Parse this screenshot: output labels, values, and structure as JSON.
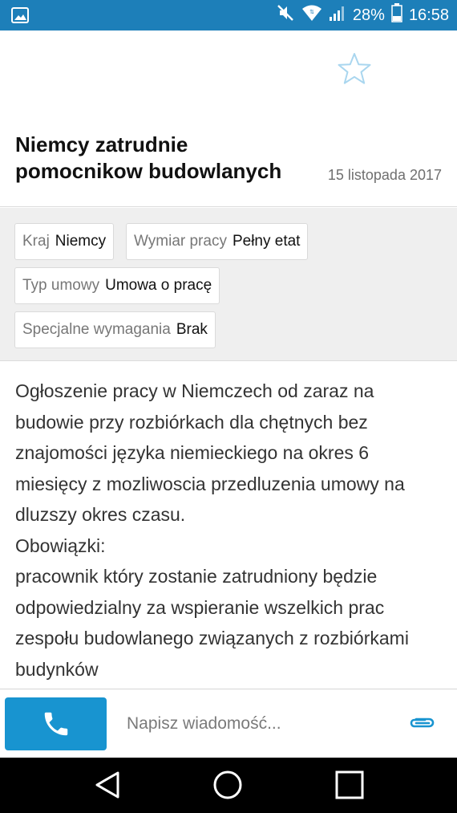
{
  "status_bar": {
    "battery": "28%",
    "time": "16:58",
    "icons": [
      "image-icon",
      "mute-icon",
      "wifi-icon",
      "signal-icon",
      "battery-icon"
    ]
  },
  "listing": {
    "title": "Niemcy zatrudnie pomocnikow budowlanych",
    "date": "15 listopada 2017"
  },
  "details": [
    {
      "label": "Kraj",
      "value": "Niemcy"
    },
    {
      "label": "Wymiar pracy",
      "value": "Pełny etat"
    },
    {
      "label": "Typ umowy",
      "value": "Umowa o pracę"
    },
    {
      "label": "Specjalne wymagania",
      "value": "Brak"
    }
  ],
  "description": {
    "intro": "Ogłoszenie pracy w Niemczech od zaraz na budowie przy rozbiórkach dla chętnych bez znajomości języka niemieckiego na okres 6 miesięcy z mozliwoscia przedluzenia umowy na dluzszy okres czasu.",
    "duties_heading": "Obowiązki:",
    "duties_text": "pracownik który zostanie zatrudniony będzie odpowiedzialny za wspieranie wszelkich prac zespołu budowlanego związanych z rozbiórkami budynków"
  },
  "compose": {
    "placeholder": "Napisz wiadomość..."
  },
  "colors": {
    "status_bar": "#1d7fb9",
    "call_button": "#1894d0",
    "accent": "#1894d0",
    "tags_background": "#efefef"
  }
}
